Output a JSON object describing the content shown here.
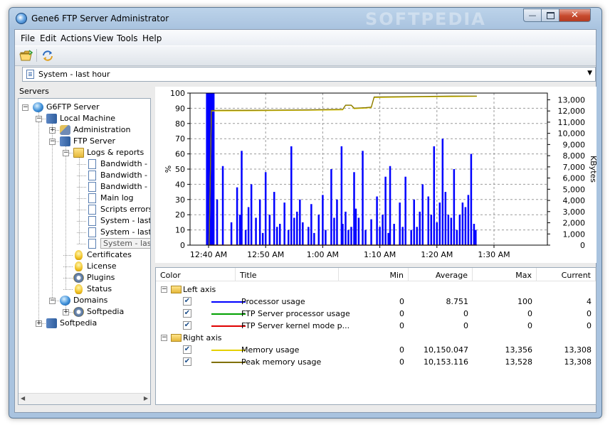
{
  "window": {
    "title": "Gene6 FTP Server Administrator",
    "watermark": "SOFTPEDIA"
  },
  "menu": [
    "File",
    "Edit",
    "Actions",
    "View",
    "Tools",
    "Help"
  ],
  "toolbar": {
    "buttons": [
      "open-folder-icon",
      "refresh-icon"
    ]
  },
  "view_selector": {
    "value": "System - last hour"
  },
  "servers_label": "Servers",
  "tree": [
    {
      "label": "G6FTP Server",
      "icon": "globe-icon"
    },
    {
      "label": "Local Machine",
      "icon": "server-icon"
    },
    {
      "label": "Administration",
      "icon": "tools-icon"
    },
    {
      "label": "FTP Server",
      "icon": "server-icon"
    },
    {
      "label": "Logs & reports",
      "icon": "folder-icon"
    },
    {
      "label": "Bandwidth - la",
      "icon": "document-icon"
    },
    {
      "label": "Bandwidth - la",
      "icon": "document-icon"
    },
    {
      "label": "Bandwidth - la",
      "icon": "document-icon"
    },
    {
      "label": "Main log",
      "icon": "document-icon"
    },
    {
      "label": "Scripts errors",
      "icon": "document-icon"
    },
    {
      "label": "System - last",
      "icon": "document-icon"
    },
    {
      "label": "System - last",
      "icon": "document-icon"
    },
    {
      "label": "System - last hour",
      "icon": "document-icon"
    },
    {
      "label": "Certificates",
      "icon": "bulb-icon"
    },
    {
      "label": "License",
      "icon": "bulb-icon"
    },
    {
      "label": "Plugins",
      "icon": "gear-icon"
    },
    {
      "label": "Status",
      "icon": "bulb-icon"
    },
    {
      "label": "Domains",
      "icon": "globe-icon"
    },
    {
      "label": "Softpedia",
      "icon": "gear-icon"
    },
    {
      "label": "Softpedia",
      "icon": "server-icon"
    }
  ],
  "chart_data": {
    "type": "line",
    "x_labels": [
      "12:40 AM",
      "12:50 AM",
      "1:00 AM",
      "1:10 AM",
      "1:20 AM",
      "1:30 AM"
    ],
    "y_left": {
      "label": "%",
      "range": [
        0,
        100
      ],
      "ticks": [
        0,
        10,
        20,
        30,
        40,
        50,
        60,
        70,
        80,
        90,
        100
      ]
    },
    "y_right": {
      "label": "KBytes",
      "range": [
        0,
        13600
      ],
      "ticks": [
        "0",
        "1,000",
        "2,000",
        "3,000",
        "4,000",
        "5,000",
        "6,000",
        "7,000",
        "8,000",
        "9,000",
        "10,000",
        "11,000",
        "12,000",
        "13,000"
      ]
    },
    "grid": true,
    "series": [
      {
        "name": "Processor usage",
        "axis": "left",
        "color": "#0000ff",
        "style": "bar",
        "x": [
          12.8,
          13.0,
          13.3,
          14.0,
          15.0,
          16.5,
          17.5,
          18.0,
          18.3,
          19.0,
          19.5,
          20.0,
          20.8,
          21.5,
          22.0,
          22.5,
          23.2,
          24.0,
          24.5,
          25.0,
          25.8,
          26.5,
          27.0,
          27.5,
          28.0,
          28.5,
          29.0,
          30.0,
          30.5,
          31.0,
          31.8,
          32.5,
          33.0,
          34.0,
          34.5,
          35.0,
          35.8,
          36.0,
          36.5,
          37.0,
          37.5,
          38.0,
          38.3,
          38.8,
          39.5,
          40.0,
          41.0,
          42.0,
          42.5,
          43.0,
          43.5,
          44.0,
          44.3,
          45.0,
          46.0,
          46.5,
          47.0,
          48.0,
          48.5,
          49.0,
          49.5,
          50.0,
          51.0,
          51.5,
          52.0,
          52.5,
          53.0,
          53.5,
          54.0,
          54.5,
          55.0,
          55.5,
          56.0,
          56.5,
          57.0,
          57.5,
          58.0,
          58.5,
          59.0,
          59.3
        ],
        "values": [
          100,
          12,
          45,
          30,
          52,
          15,
          38,
          20,
          62,
          10,
          25,
          40,
          18,
          30,
          8,
          48,
          20,
          35,
          12,
          14,
          28,
          10,
          65,
          18,
          22,
          30,
          15,
          12,
          27,
          8,
          20,
          33,
          10,
          50,
          18,
          30,
          65,
          14,
          22,
          10,
          12,
          48,
          24,
          18,
          62,
          10,
          17,
          32,
          12,
          20,
          45,
          8,
          52,
          14,
          28,
          12,
          45,
          10,
          30,
          12,
          22,
          40,
          32,
          20,
          65,
          15,
          28,
          70,
          35,
          20,
          18,
          50,
          10,
          20,
          28,
          25,
          33,
          60,
          14,
          10
        ]
      },
      {
        "name": "FTP Server processor usage",
        "axis": "left",
        "color": "#00a000",
        "x": [
          12.5,
          59.5
        ],
        "values": [
          0,
          0
        ]
      },
      {
        "name": "FTP Server kernel mode p...",
        "axis": "left",
        "color": "#ff0000",
        "x": [
          12.5,
          59.5
        ],
        "values": [
          0,
          0
        ]
      },
      {
        "name": "Memory usage",
        "axis": "right",
        "color": "#e5d100",
        "x": [
          12.6,
          13.0,
          14.0,
          20.0,
          30.0,
          36.0,
          36.5,
          37.5,
          38.0,
          40.0,
          41.0,
          41.5,
          50.0,
          55.0,
          59.5
        ],
        "values": [
          0,
          12000,
          12000,
          12020,
          12070,
          12100,
          12500,
          12500,
          12200,
          12250,
          12300,
          13200,
          13260,
          13280,
          13300
        ]
      },
      {
        "name": "Peak memory usage",
        "axis": "right",
        "color": "#807000",
        "x": [
          12.6,
          13.0,
          14.0,
          20.0,
          30.0,
          36.0,
          36.5,
          37.5,
          38.0,
          40.0,
          41.0,
          41.5,
          50.0,
          55.0,
          59.5
        ],
        "values": [
          0,
          12050,
          12060,
          12070,
          12100,
          12150,
          12520,
          12520,
          12250,
          12300,
          12350,
          13250,
          13300,
          13330,
          13330
        ]
      }
    ]
  },
  "grid": {
    "columns": [
      "Color",
      "Title",
      "Min",
      "Average",
      "Max",
      "Current"
    ],
    "groups": [
      {
        "name": "Left axis",
        "rows": [
          {
            "title": "Processor usage",
            "color": "#0000ff",
            "min": "0",
            "avg": "8.751",
            "max": "100",
            "cur": "4"
          },
          {
            "title": "FTP Server processor usage",
            "color": "#00a000",
            "min": "0",
            "avg": "0",
            "max": "0",
            "cur": "0"
          },
          {
            "title": "FTP Server kernel mode p...",
            "color": "#e00000",
            "min": "0",
            "avg": "0",
            "max": "0",
            "cur": "0"
          }
        ]
      },
      {
        "name": "Right axis",
        "rows": [
          {
            "title": "Memory usage",
            "color": "#e5d100",
            "min": "0",
            "avg": "10,150.047",
            "max": "13,356",
            "cur": "13,308"
          },
          {
            "title": "Peak memory usage",
            "color": "#807000",
            "min": "0",
            "avg": "10,153.116",
            "max": "13,528",
            "cur": "13,308"
          }
        ]
      }
    ]
  }
}
